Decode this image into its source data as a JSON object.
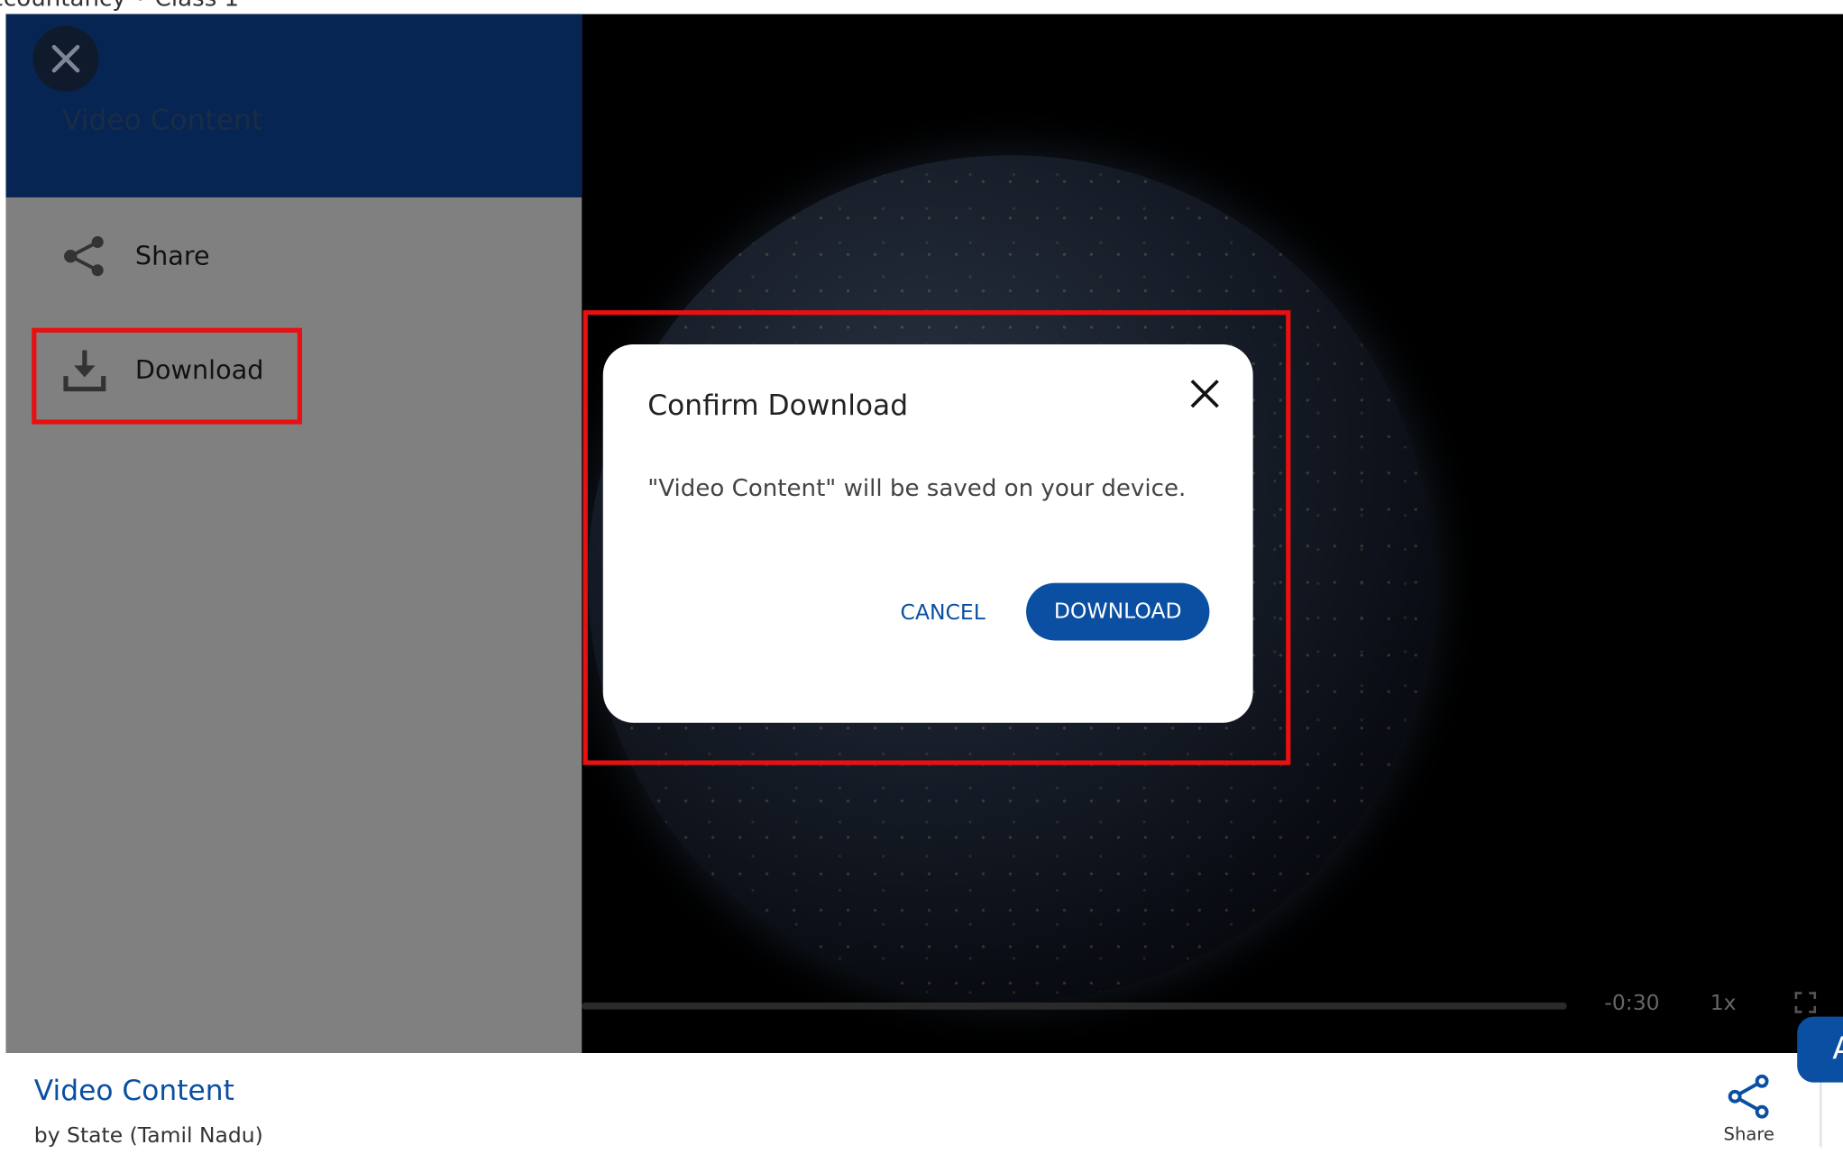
{
  "breadcrumb": "ccountancy  •  Class 1",
  "side_panel": {
    "title": "Video Content",
    "items": [
      {
        "label": "Share",
        "icon": "share-icon"
      },
      {
        "label": "Download",
        "icon": "download-icon"
      }
    ]
  },
  "player": {
    "time_remaining": "-0:30",
    "speed": "1x"
  },
  "dialog": {
    "title": "Confirm Download",
    "message": "\"Video Content\" will be saved on your device.",
    "cancel_label": "CANCEL",
    "download_label": "DOWNLOAD"
  },
  "footer": {
    "title": "Video Content",
    "subtitle": "by State (Tamil Nadu)",
    "share_label": "Share"
  },
  "fab": {
    "label": "A"
  },
  "colors": {
    "brand_blue": "#0b4fa3",
    "panel_header": "#062552",
    "highlight": "#e81010",
    "overlay_gray": "#808080"
  }
}
